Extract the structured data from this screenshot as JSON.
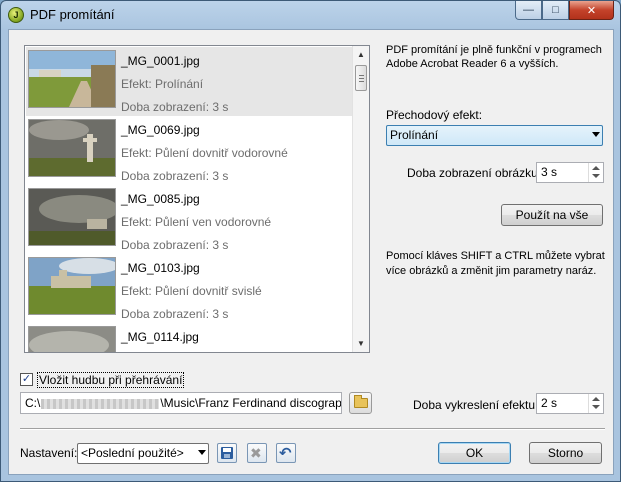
{
  "window": {
    "title": "PDF promítání",
    "icon_letter": "J",
    "caption": {
      "minimize": "—",
      "maximize": "□",
      "close": "✕"
    }
  },
  "slides": [
    {
      "name": "_MG_0001.jpg",
      "effect": "Efekt: Prolínání",
      "duration": "Doba zobrazení: 3 s",
      "selected": true
    },
    {
      "name": "_MG_0069.jpg",
      "effect": "Efekt: Půlení dovnitř vodorovné",
      "duration": "Doba zobrazení: 3 s",
      "selected": false
    },
    {
      "name": "_MG_0085.jpg",
      "effect": "Efekt: Půlení ven vodorovné",
      "duration": "Doba zobrazení: 3 s",
      "selected": false
    },
    {
      "name": "_MG_0103.jpg",
      "effect": "Efekt: Půlení dovnitř svislé",
      "duration": "Doba zobrazení: 3 s",
      "selected": false
    },
    {
      "name": "_MG_0114.jpg",
      "effect": "",
      "duration": "",
      "selected": false
    }
  ],
  "right_panel": {
    "info": "PDF promítání je plně funkční v programech Adobe Acrobat Reader 6 a vyšších.",
    "transition_label": "Přechodový efekt:",
    "transition_value": "Prolínání",
    "display_time_label": "Doba zobrazení obrázku:",
    "display_time_value": "3 s",
    "apply_all_button": "Použít na vše",
    "help": "Pomocí kláves SHIFT a CTRL můžete vybrat více obrázků a změnit jim parametry naráz."
  },
  "music": {
    "checkbox_label": "Vložit hudbu při přehrávání",
    "checked": true,
    "path_prefix": "C:\\",
    "path_suffix": "\\Music\\Franz Ferdinand discography\\To",
    "effect_render_label": "Doba vykreslení efektu:",
    "effect_render_value": "2 s"
  },
  "footer": {
    "settings_label": "Nastavení:",
    "settings_value": "<Poslední použité>",
    "ok_button": "OK",
    "cancel_button": "Storno"
  }
}
